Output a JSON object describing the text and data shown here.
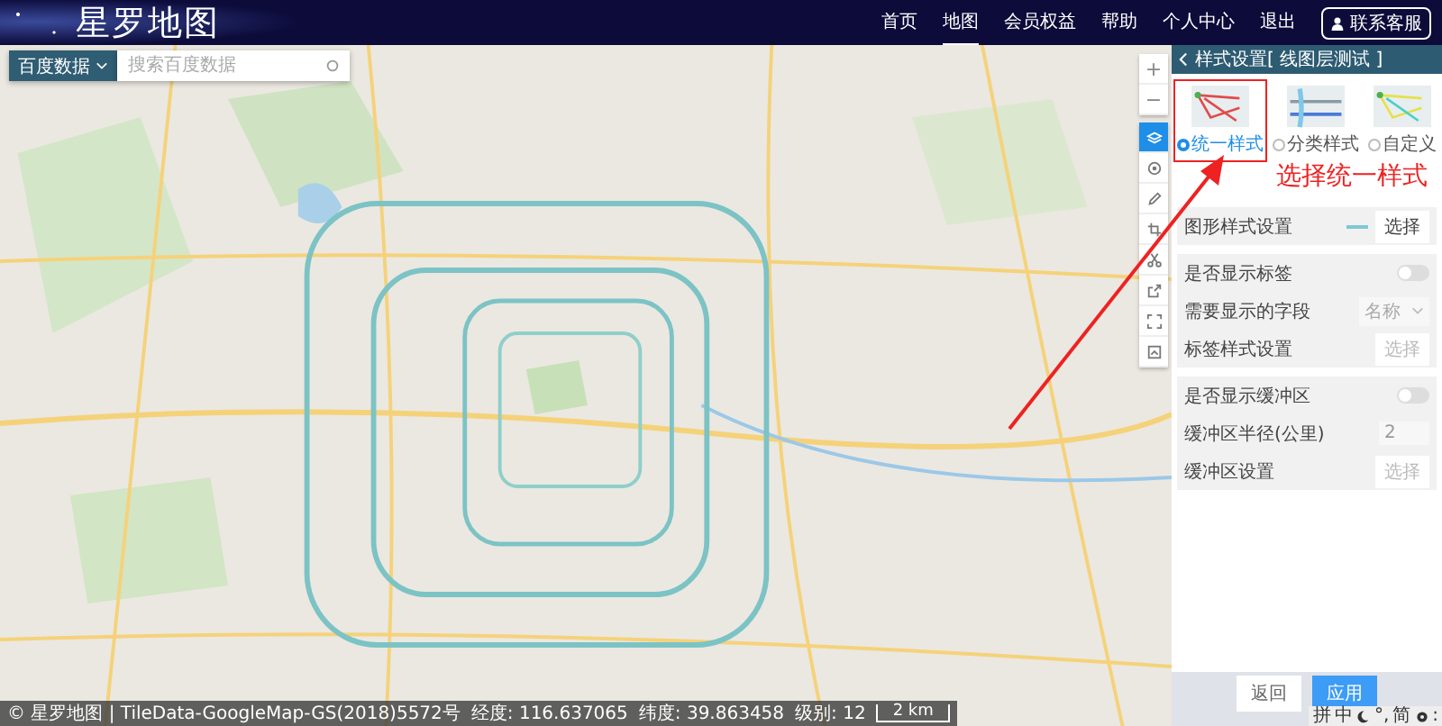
{
  "header": {
    "logo": "星罗地图",
    "nav": [
      {
        "label": "首页",
        "selected": false
      },
      {
        "label": "地图",
        "selected": true
      },
      {
        "label": "会员权益",
        "selected": false
      },
      {
        "label": "帮助",
        "selected": false
      },
      {
        "label": "个人中心",
        "selected": false
      },
      {
        "label": "退出",
        "selected": false
      }
    ],
    "contact_button": "联系客服"
  },
  "search": {
    "source": "百度数据",
    "placeholder": "搜索百度数据"
  },
  "map_controls": {
    "zoom_in": "+",
    "zoom_out": "−",
    "tools": [
      {
        "kind": "layers",
        "selected": true
      },
      {
        "kind": "target",
        "selected": false
      },
      {
        "kind": "pencil",
        "selected": false
      },
      {
        "kind": "crop",
        "selected": false
      },
      {
        "kind": "scissors",
        "selected": false
      },
      {
        "kind": "export",
        "selected": false
      },
      {
        "kind": "fullscreen",
        "selected": false
      },
      {
        "kind": "screenshot",
        "selected": false
      }
    ]
  },
  "panel": {
    "title": "样式设置[ 线图层测试 ]",
    "styles": [
      {
        "kind": "unified",
        "label": "统一样式",
        "selected": true
      },
      {
        "kind": "category",
        "label": "分类样式",
        "selected": false
      },
      {
        "kind": "custom",
        "label": "自定义",
        "selected": false
      }
    ],
    "groups": [
      [
        {
          "kind": "style_button",
          "label": "图形样式设置",
          "value": "选择",
          "disabled": false
        }
      ],
      [
        {
          "kind": "toggle",
          "label": "是否显示标签",
          "on": false
        },
        {
          "kind": "select",
          "label": "需要显示的字段",
          "value": "名称",
          "disabled": true
        },
        {
          "kind": "button",
          "label": "标签样式设置",
          "value": "选择",
          "disabled": true
        }
      ],
      [
        {
          "kind": "toggle",
          "label": "是否显示缓冲区",
          "on": false
        },
        {
          "kind": "input",
          "label": "缓冲区半径(公里)",
          "value": "2",
          "disabled": true
        },
        {
          "kind": "button",
          "label": "缓冲区设置",
          "value": "选择",
          "disabled": true
        }
      ]
    ],
    "buttons": [
      {
        "kind": "secondary",
        "label": "返回"
      },
      {
        "kind": "primary",
        "label": "应用"
      }
    ]
  },
  "annotation": "选择统一样式",
  "status_bar": {
    "copyright": "© 星罗地图 | TileData-GoogleMap-GS(2018)5572号",
    "longitude": "经度: 116.637065",
    "latitude": "纬度: 39.863458",
    "zoom": "级别: 12",
    "scale": "2 km"
  },
  "ime_toolbar": [
    {
      "kind": "text",
      "label": "拼"
    },
    {
      "kind": "text",
      "label": "中"
    },
    {
      "kind": "moon"
    },
    {
      "kind": "text",
      "label": "°,"
    },
    {
      "kind": "text",
      "label": "简"
    },
    {
      "kind": "gear"
    },
    {
      "kind": "text",
      "label": ":"
    }
  ]
}
